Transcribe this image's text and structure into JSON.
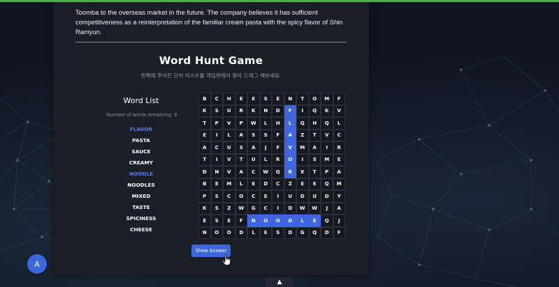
{
  "article": {
    "text": "Toomba to the overseas market in the future.  The company believes it has sufficient competitiveness as a reinterpretation of the familiar cream pasta with the spicy flavor of Shin Ramyun."
  },
  "game": {
    "title": "Word Hunt Game",
    "subtitle": "왼쪽에 주어진 단어 리스트를 게임판에서 찾아 드래그 해보세요.",
    "word_list_title": "Word List",
    "remaining_label": "Number of words remaining: 8",
    "words": [
      {
        "text": "FLAVOR",
        "found": true
      },
      {
        "text": "PASTA",
        "found": false
      },
      {
        "text": "SAUCE",
        "found": false
      },
      {
        "text": "CREAMY",
        "found": false
      },
      {
        "text": "NOODLE",
        "found": true
      },
      {
        "text": "NOODLES",
        "found": false
      },
      {
        "text": "MIXED",
        "found": false
      },
      {
        "text": "TASTE",
        "found": false
      },
      {
        "text": "SPICINESS",
        "found": false
      },
      {
        "text": "CHEESE",
        "found": false
      }
    ],
    "grid": [
      "BCHEESENTOMF",
      "KSURKNDFIQKV",
      "TPVPWLHLQHQL",
      "EILASSFAZTVC",
      "ACUSAJFVMAIR",
      "TIVTULROISME",
      "DNVACWQRXTPA",
      "BEMLEDCZEEQM",
      "PSCOCEIUDUDY",
      "KSZWGCIDWWJA",
      "ESEFNOODLEQJ",
      "NOODLESDGQDF"
    ],
    "highlighted": [
      [
        1,
        7
      ],
      [
        2,
        7
      ],
      [
        3,
        7
      ],
      [
        4,
        7
      ],
      [
        5,
        7
      ],
      [
        6,
        7
      ],
      [
        10,
        4
      ],
      [
        10,
        5
      ],
      [
        10,
        6
      ],
      [
        10,
        7
      ],
      [
        10,
        8
      ],
      [
        10,
        9
      ]
    ],
    "show_answer_label": "Show Answer"
  },
  "fab": {
    "label": "A"
  },
  "scroll_top": {
    "label": "▲"
  },
  "colors": {
    "accent": "#3d67df",
    "found_word": "#5a7bea",
    "top_bar": "#4caf50"
  }
}
